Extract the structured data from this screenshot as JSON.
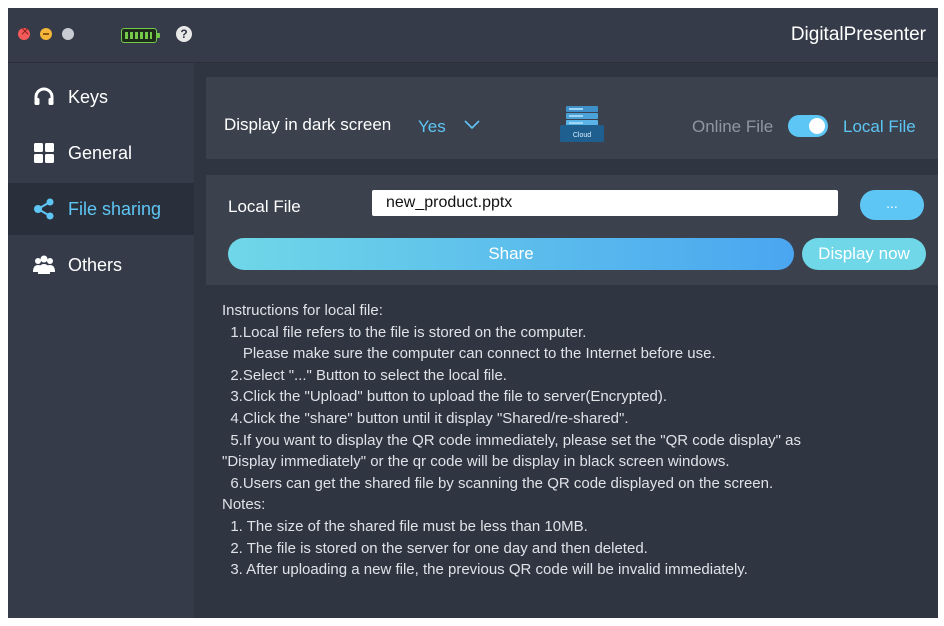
{
  "window": {
    "title": "DigitalPresenter",
    "accent": "#5ec6f5"
  },
  "titlebar": {
    "battery_icon": "battery-icon",
    "help_icon": "help-icon",
    "help_glyph": "?"
  },
  "sidebar": {
    "items": [
      {
        "label": "Keys",
        "icon": "headphones-icon"
      },
      {
        "label": "General",
        "icon": "grid-icon"
      },
      {
        "label": "File sharing",
        "icon": "share-icon",
        "active": true
      },
      {
        "label": "Others",
        "icon": "users-icon"
      }
    ]
  },
  "settings": {
    "dark_screen_label": "Display in dark screen",
    "dark_screen_value": "Yes",
    "cloud_icon_text": "Cloud",
    "online_label": "Online File",
    "local_label": "Local File",
    "toggle_state": "local"
  },
  "file_panel": {
    "label": "Local File",
    "value": "new_product.pptx",
    "browse_label": "...",
    "share_label": "Share",
    "display_label": "Display now"
  },
  "instructions": {
    "lines": [
      "Instructions for local file:",
      "  1.Local file refers to the file is stored on the computer.",
      "     Please make sure the computer can connect to the Internet before use.",
      "  2.Select \"...\" Button to select the local file.",
      "  3.Click the \"Upload\" button to upload the file to server(Encrypted).",
      "  4.Click the \"share\" button until it display \"Shared/re-shared\".",
      "  5.If you want to display the QR code immediately, please set the \"QR code display\" as",
      "\"Display immediately\" or the qr code will be display in black screen windows.",
      "  6.Users can get the shared file by scanning the QR code displayed on the screen.",
      "Notes:",
      "  1. The size of the shared file must be less than 10MB.",
      "  2. The file is stored on the server for one day and then deleted.",
      "  3. After uploading a new file, the previous QR code will be invalid immediately."
    ]
  }
}
